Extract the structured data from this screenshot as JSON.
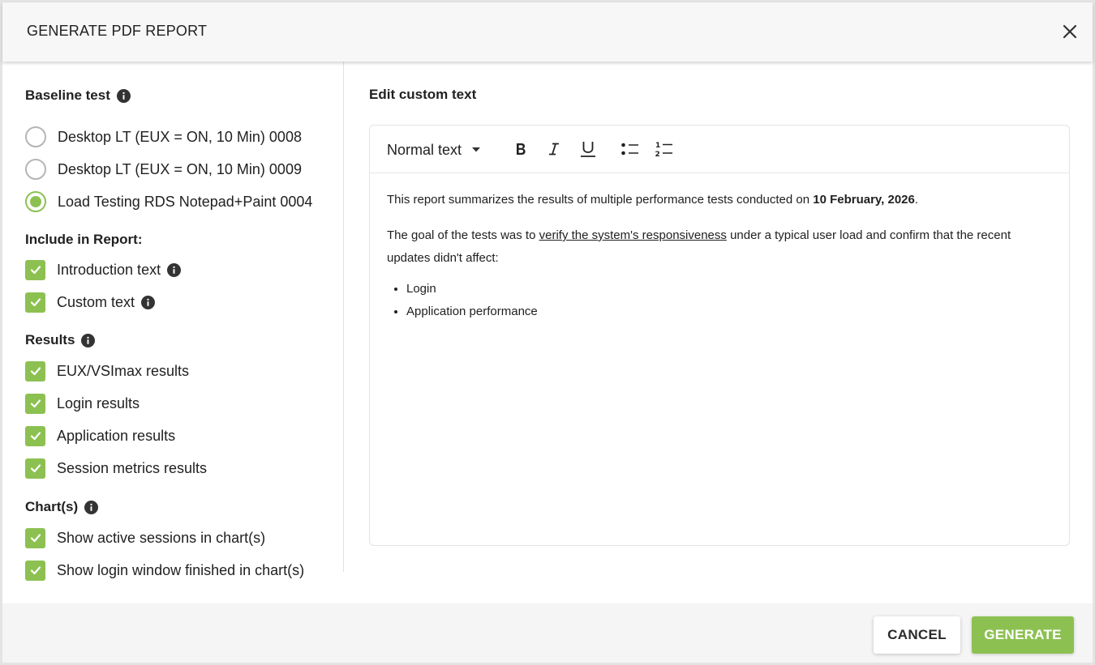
{
  "dialog": {
    "title": "GENERATE PDF REPORT"
  },
  "baseline": {
    "title": "Baseline test",
    "options": [
      {
        "label": "Desktop LT (EUX = ON, 10 Min) 0008",
        "selected": false
      },
      {
        "label": "Desktop LT (EUX = ON, 10 Min) 0009",
        "selected": false
      },
      {
        "label": "Load Testing RDS Notepad+Paint 0004",
        "selected": true
      }
    ]
  },
  "include": {
    "title": "Include in Report:",
    "items": [
      {
        "label": "Introduction text",
        "checked": true
      },
      {
        "label": "Custom text",
        "checked": true
      }
    ]
  },
  "results": {
    "title": "Results",
    "items": [
      {
        "label": "EUX/VSImax results",
        "checked": true
      },
      {
        "label": "Login results",
        "checked": true
      },
      {
        "label": "Application results",
        "checked": true
      },
      {
        "label": "Session metrics results",
        "checked": true
      }
    ]
  },
  "charts": {
    "title": "Chart(s)",
    "items": [
      {
        "label": "Show active sessions in chart(s)",
        "checked": true
      },
      {
        "label": "Show login window finished in chart(s)",
        "checked": true
      }
    ]
  },
  "editor": {
    "title": "Edit custom text",
    "format_value": "Normal text",
    "toolbar_icons": [
      "bold-icon",
      "italic-icon",
      "underline-icon",
      "bullet-list-icon",
      "numbered-list-icon"
    ],
    "p1_before": "This report summarizes the results of multiple performance tests conducted on ",
    "p1_bold": "10 February, 2026",
    "p1_after": ".",
    "p2_before": "The goal of the tests was to ",
    "p2_underline": "verify the system's responsiveness",
    "p2_after": " under a typical user load and confirm that the recent updates didn't affect:",
    "bullets": [
      "Login",
      "Application performance"
    ]
  },
  "footer": {
    "cancel_label": "CANCEL",
    "generate_label": "GENERATE"
  },
  "colors": {
    "accent": "#8cc152",
    "header_bg": "#f7f7f7",
    "footer_bg": "#f5f5f5"
  }
}
